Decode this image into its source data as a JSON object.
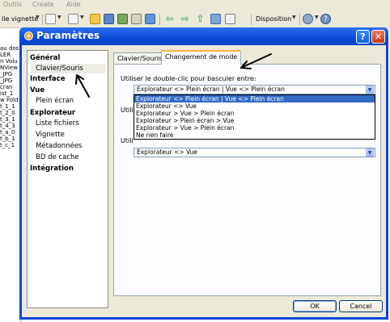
{
  "menubar": {
    "items": [
      "Outils",
      "Create",
      "Aide"
    ]
  },
  "toolbar": {
    "view_combo": "lle vignette",
    "disposition_label": "Disposition"
  },
  "left_panel": {
    "rows": [
      "au dos",
      "LER",
      "n Volu",
      "NView",
      "_JPG",
      "_JPG",
      "cran",
      "ist_1",
      "w Fold",
      "t_1_1",
      "t_2_0",
      "t_3_1",
      "t_4_3",
      "t_a_0",
      "t_b_1",
      "t_c_1"
    ]
  },
  "dialog": {
    "title": "Paramètres",
    "help_label": "?",
    "close_label": "✕",
    "nav": {
      "general": "Général",
      "clavier_souris": "Clavier/Souris",
      "interface": "Interface",
      "vue": "Vue",
      "plein_ecran": "Plein écran",
      "explorateur": "Explorateur",
      "liste_fichiers": "Liste fichiers",
      "vignette": "Vignette",
      "metadonnees": "Métadonnées",
      "bd_cache": "BD de cache",
      "integration": "Intégration"
    },
    "tabs": {
      "tab1": "Clavier/Souris",
      "tab2": "Changement de mode"
    },
    "pane": {
      "label1": "Utiliser le double-clic pour basculer entre:",
      "label2": "Utili",
      "label3": "Utili",
      "combo1_value": "Explorateur <> Plein écran | Vue <> Plein écran",
      "combo3_value": "Explorateur <> Vue",
      "options": [
        "Explorateur <> Plein écran | Vue <> Plein écran",
        "Explorateur <> Vue",
        "Explorateur > Vue > Plein écran",
        "Explorateur > Plein écran > Vue",
        "Explorateur > Vue > Plein écran",
        "Ne rien faire"
      ]
    },
    "ok_label": "OK",
    "cancel_label": "Cancel"
  },
  "colors": {
    "title_bar": "#0a4ad8",
    "selection": "#316ac5",
    "tab_accent": "#f7b13a",
    "annotation_arrow": "#000000"
  }
}
